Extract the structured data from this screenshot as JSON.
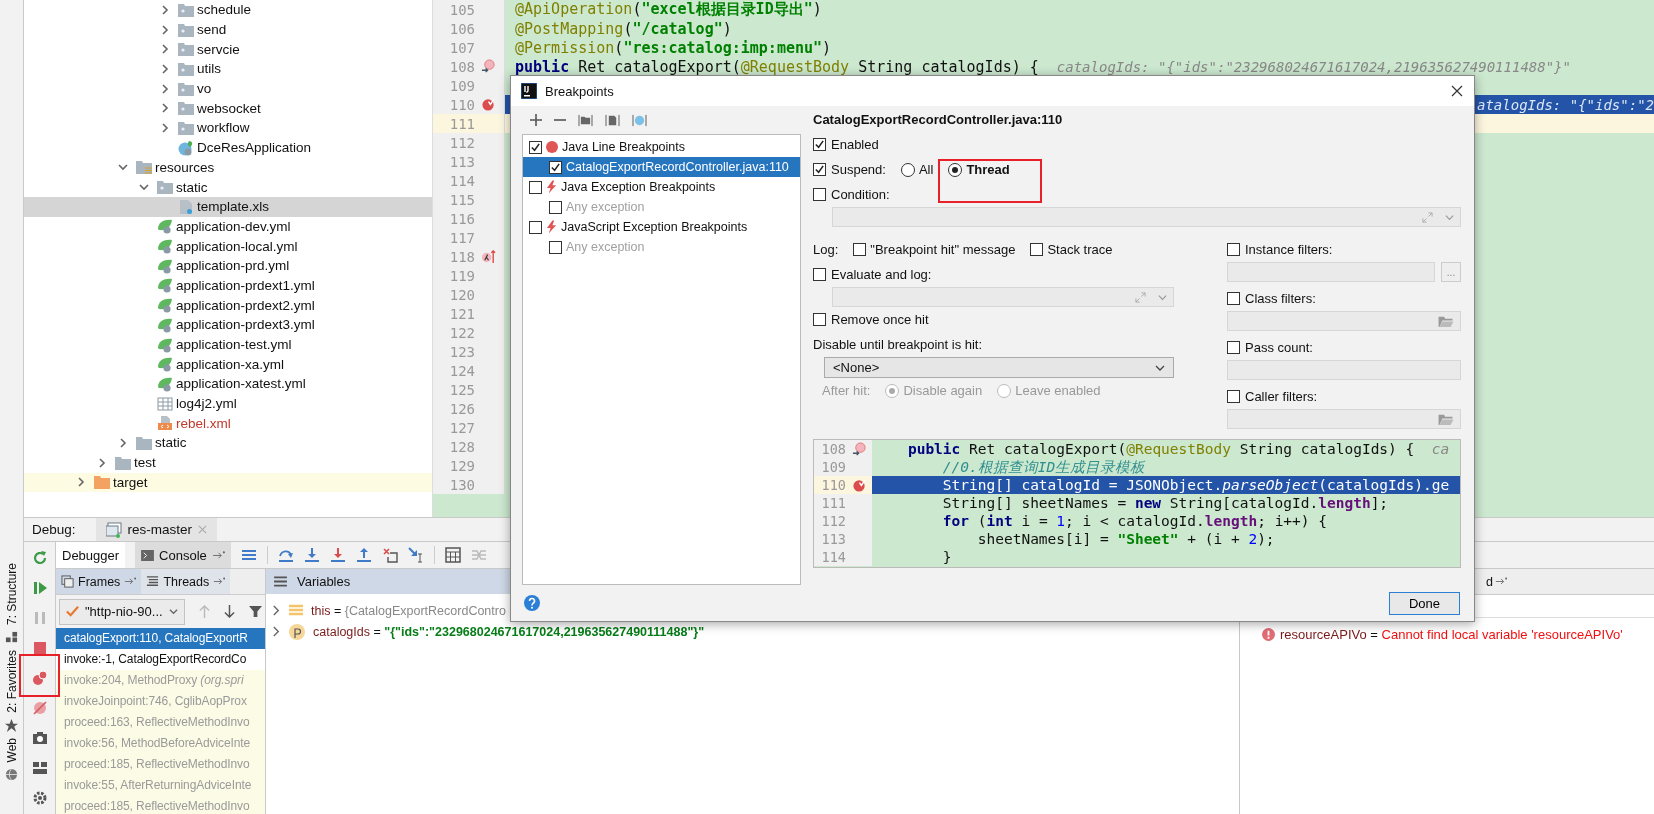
{
  "project_tree": [
    {
      "children": [
        {
          "children": [
            {
              "children": [
                {
                  "children": [
                    {
                      "label": "schedule",
                      "kind": "package",
                      "expanded": false,
                      "selected": false
                    },
                    {
                      "label": "send",
                      "kind": "package",
                      "expanded": false,
                      "selected": false
                    },
                    {
                      "label": "servcie",
                      "kind": "package",
                      "expanded": false,
                      "selected": false
                    },
                    {
                      "label": "utils",
                      "kind": "package",
                      "expanded": false,
                      "selected": false
                    },
                    {
                      "label": "vo",
                      "kind": "package",
                      "expanded": false,
                      "selected": false
                    },
                    {
                      "label": "websocket",
                      "kind": "package",
                      "expanded": false,
                      "selected": false
                    },
                    {
                      "label": "workflow",
                      "kind": "package",
                      "expanded": false,
                      "selected": false
                    },
                    {
                      "label": "DceResApplication",
                      "kind": "spring-class",
                      "selected": false
                    }
                  ]
                }
              ]
            },
            {
              "label": "resources",
              "kind": "resources",
              "expanded": true,
              "selected": false,
              "children": [
                {
                  "label": "static",
                  "kind": "package",
                  "expanded": true,
                  "selected": false,
                  "children": [
                    {
                      "label": "template.xls",
                      "kind": "unknown-file",
                      "selected": true
                    }
                  ]
                },
                {
                  "label": "application-dev.yml",
                  "kind": "spring-config",
                  "selected": false
                },
                {
                  "label": "application-local.yml",
                  "kind": "spring-config",
                  "selected": false
                },
                {
                  "label": "application-prd.yml",
                  "kind": "spring-config",
                  "selected": false
                },
                {
                  "label": "application-prdext1.yml",
                  "kind": "spring-config",
                  "selected": false
                },
                {
                  "label": "application-prdext2.yml",
                  "kind": "spring-config",
                  "selected": false
                },
                {
                  "label": "application-prdext3.yml",
                  "kind": "spring-config",
                  "selected": false
                },
                {
                  "label": "application-test.yml",
                  "kind": "spring-config",
                  "selected": false
                },
                {
                  "label": "application-xa.yml",
                  "kind": "spring-config",
                  "selected": false
                },
                {
                  "label": "application-xatest.yml",
                  "kind": "spring-config",
                  "selected": false
                },
                {
                  "label": "log4j2.yml",
                  "kind": "table-file",
                  "selected": false
                },
                {
                  "label": "rebel.xml",
                  "kind": "xml-file",
                  "selected": false
                }
              ]
            },
            {
              "label": "static",
              "kind": "plain-folder",
              "expanded": false,
              "selected": false
            }
          ]
        },
        {
          "label": "test",
          "kind": "plain-folder",
          "expanded": false,
          "selected": false
        }
      ]
    },
    {
      "label": "target",
      "kind": "excluded-folder",
      "expanded": false,
      "selected": false
    }
  ],
  "editor": {
    "lines": [
      {
        "number": "105",
        "highlighted": false,
        "caret": false,
        "code": [
          {
            "kind": "annotation",
            "text": "@ApiOperation"
          },
          {
            "kind": "plain",
            "text": "("
          },
          {
            "kind": "string",
            "text": "\"excel根据目录ID导出\""
          },
          {
            "kind": "plain",
            "text": ")"
          }
        ]
      },
      {
        "number": "106",
        "highlighted": false,
        "caret": false,
        "code": [
          {
            "kind": "annotation",
            "text": "@PostMapping"
          },
          {
            "kind": "plain",
            "text": "("
          },
          {
            "kind": "string",
            "text": "\"/catalog\""
          },
          {
            "kind": "plain",
            "text": ")"
          }
        ]
      },
      {
        "number": "107",
        "highlighted": false,
        "caret": false,
        "code": [
          {
            "kind": "annotation",
            "text": "@Permission"
          },
          {
            "kind": "plain",
            "text": "("
          },
          {
            "kind": "string",
            "text": "\"res:catalog:imp:menu\""
          },
          {
            "kind": "plain",
            "text": ")"
          }
        ]
      },
      {
        "number": "108",
        "kind": "override",
        "highlighted": false,
        "caret": false,
        "code": [
          {
            "kind": "keyword",
            "text": "public"
          },
          {
            "kind": "plain",
            "text": " Ret catalogExport("
          },
          {
            "kind": "annotation",
            "text": "@RequestBody"
          },
          {
            "kind": "plain",
            "text": " String catalogIds) {"
          }
        ],
        "hint": "catalogIds: \"{\"ids\":\"232968024671617024,219635627490111488\"}\""
      },
      {
        "number": "109",
        "highlighted": false,
        "caret": false
      },
      {
        "number": "110",
        "kind": "breakpoint",
        "highlighted": true,
        "caret": false,
        "hint": "atalogIds: \"{\"ids\":\"2"
      },
      {
        "number": "111",
        "highlighted": false,
        "caret": true
      },
      {
        "number": "112",
        "highlighted": false,
        "caret": false
      },
      {
        "number": "113",
        "highlighted": false,
        "caret": false
      },
      {
        "number": "114",
        "highlighted": false,
        "caret": false
      },
      {
        "number": "115",
        "highlighted": false,
        "caret": false
      },
      {
        "number": "116",
        "highlighted": false,
        "caret": false
      },
      {
        "number": "117",
        "highlighted": false,
        "caret": false
      },
      {
        "number": "118",
        "kind": "lambda",
        "highlighted": false,
        "caret": false
      },
      {
        "number": "119",
        "highlighted": false,
        "caret": false
      },
      {
        "number": "120",
        "highlighted": false,
        "caret": false
      },
      {
        "number": "121",
        "highlighted": false,
        "caret": false
      },
      {
        "number": "122",
        "highlighted": false,
        "caret": false
      },
      {
        "number": "123",
        "highlighted": false,
        "caret": false
      },
      {
        "number": "124",
        "highlighted": false,
        "caret": false
      },
      {
        "number": "125",
        "highlighted": false,
        "caret": false
      },
      {
        "number": "126",
        "highlighted": false,
        "caret": false
      },
      {
        "number": "127",
        "highlighted": false,
        "caret": false
      },
      {
        "number": "128",
        "highlighted": false,
        "caret": false
      },
      {
        "number": "129",
        "highlighted": false,
        "caret": false
      },
      {
        "number": "130",
        "highlighted": false,
        "caret": false
      }
    ]
  },
  "side_tabs": [
    "7: Structure",
    "2: Favorites",
    "Web"
  ],
  "debug": {
    "label": "Debug:",
    "session_tab": "res-master",
    "tabs": [
      {
        "label": "Debugger",
        "selected": true
      },
      {
        "label": "Console",
        "selected": false
      }
    ],
    "frame_tabs": [
      {
        "label": "Frames",
        "selected": true
      },
      {
        "label": "Threads",
        "selected": false
      }
    ],
    "thread": "\"http-nio-90...",
    "frames": [
      {
        "text": "catalogExport:110, CatalogExportR",
        "kind": "app",
        "selected": true
      },
      {
        "text": "invoke:-1, CatalogExportRecordCo",
        "kind": "app",
        "selected": false
      },
      {
        "text": "invoke:204, MethodProxy *(org.spri*",
        "kind": "library",
        "selected": false
      },
      {
        "text": "invokeJoinpoint:746, CglibAopProx",
        "kind": "library",
        "selected": false
      },
      {
        "text": "proceed:163, ReflectiveMethodInvo",
        "kind": "library",
        "selected": false
      },
      {
        "text": "invoke:56, MethodBeforeAdviceInte",
        "kind": "library",
        "selected": false
      },
      {
        "text": "proceed:185, ReflectiveMethodInvo",
        "kind": "library",
        "selected": false
      },
      {
        "text": "invoke:55, AfterReturningAdviceInte",
        "kind": "library",
        "selected": false
      },
      {
        "text": "proceed:185, ReflectiveMethodInvo",
        "kind": "library",
        "selected": false
      }
    ],
    "variables_title": "Variables",
    "variables": [
      {
        "name": "this",
        "sign": "=",
        "value": "{CatalogExportRecordContro",
        "kind": "object"
      },
      {
        "name": "catalogIds",
        "sign": "=",
        "value": "\"{\"ids\":\"232968024671617024,219635627490111488\"}\"",
        "kind": "param"
      }
    ],
    "watches": {
      "tab": "d",
      "items": [
        {
          "name": "resourceAPIVo",
          "sign": "=",
          "message": "Cannot find local variable 'resourceAPIVo'",
          "kind": "error"
        }
      ]
    }
  },
  "dialog": {
    "title": "Breakpoints",
    "groups": [
      {
        "label": "Java Line Breakpoints",
        "kind": "line",
        "checked": true,
        "selected": false,
        "children": [
          {
            "label": "CatalogExportRecordController.java:110",
            "checked": true,
            "selected": true,
            "disabled": false
          }
        ]
      },
      {
        "label": "Java Exception Breakpoints",
        "kind": "exception",
        "checked": false,
        "selected": false,
        "children": [
          {
            "label": "Any exception",
            "checked": false,
            "selected": false,
            "disabled": true
          }
        ]
      },
      {
        "label": "JavaScript Exception Breakpoints",
        "kind": "exception",
        "checked": false,
        "selected": false,
        "children": [
          {
            "label": "Any exception",
            "checked": false,
            "selected": false,
            "disabled": true
          }
        ]
      }
    ],
    "heading": "CatalogExportRecordController.java:110",
    "enabled": {
      "label": "Enabled",
      "checked": true
    },
    "suspend": {
      "label": "Suspend:",
      "checked": true,
      "options": [
        {
          "label": "All",
          "selected": false
        },
        {
          "label": "Thread",
          "selected": true
        }
      ]
    },
    "condition": {
      "label": "Condition:",
      "checked": false
    },
    "log_label": "Log:",
    "log_options": [
      {
        "label": "\"Breakpoint hit\" message",
        "checked": false
      },
      {
        "label": "Stack trace",
        "checked": false
      }
    ],
    "evaluate": {
      "label": "Evaluate and log:",
      "checked": false
    },
    "remove_once_hit": {
      "label": "Remove once hit",
      "checked": false
    },
    "disable_until": {
      "label": "Disable until breakpoint is hit:",
      "value": "<None>"
    },
    "after_hit": {
      "label": "After hit:",
      "disabled": true,
      "options": [
        {
          "label": "Disable again",
          "selected": true
        },
        {
          "label": "Leave enabled",
          "selected": false
        }
      ]
    },
    "filters": [
      {
        "label": "Instance filters:",
        "checked": false,
        "button_text": "..."
      },
      {
        "label": "Class filters:",
        "checked": false,
        "kind": "folder"
      },
      {
        "label": "Pass count:",
        "checked": false
      },
      {
        "label": "Caller filters:",
        "checked": false,
        "kind": "folder"
      }
    ],
    "preview": [
      {
        "number": "108",
        "kind": "override",
        "highlighted": false,
        "code": [
          {
            "kind": "keyword",
            "text": "    public"
          },
          {
            "kind": "plain",
            "text": " Ret catalogExport("
          },
          {
            "kind": "annotation",
            "text": "@RequestBody"
          },
          {
            "kind": "plain",
            "text": " String catalogIds) {  "
          },
          {
            "kind": "hint",
            "text": "ca"
          }
        ]
      },
      {
        "number": "109",
        "highlighted": false,
        "code": [
          {
            "kind": "comment",
            "text": "        //0.根据查询ID生成目录模板"
          }
        ]
      },
      {
        "number": "110",
        "kind": "breakpoint",
        "highlighted": true,
        "code": [
          {
            "kind": "plain",
            "text": "        String[] catalogId = JSONObject."
          },
          {
            "kind": "italic",
            "text": "parseObject"
          },
          {
            "kind": "plain",
            "text": "(catalogIds).ge"
          }
        ]
      },
      {
        "number": "111",
        "highlighted": false,
        "code": [
          {
            "kind": "plain",
            "text": "        String[] sheetNames = "
          },
          {
            "kind": "keyword",
            "text": "new"
          },
          {
            "kind": "plain",
            "text": " String[catalogId."
          },
          {
            "kind": "field",
            "text": "length"
          },
          {
            "kind": "plain",
            "text": "];"
          }
        ]
      },
      {
        "number": "112",
        "highlighted": false,
        "code": [
          {
            "kind": "keyword",
            "text": "        for"
          },
          {
            "kind": "plain",
            "text": " ("
          },
          {
            "kind": "keyword",
            "text": "int"
          },
          {
            "kind": "plain",
            "text": " i = "
          },
          {
            "kind": "number",
            "text": "1"
          },
          {
            "kind": "plain",
            "text": "; i < catalogId."
          },
          {
            "kind": "field",
            "text": "length"
          },
          {
            "kind": "plain",
            "text": "; i++) {"
          }
        ]
      },
      {
        "number": "113",
        "highlighted": false,
        "code": [
          {
            "kind": "plain",
            "text": "            sheetNames[i] = "
          },
          {
            "kind": "string",
            "text": "\"Sheet\""
          },
          {
            "kind": "plain",
            "text": " + (i + "
          },
          {
            "kind": "number",
            "text": "2"
          },
          {
            "kind": "plain",
            "text": ");"
          }
        ]
      },
      {
        "number": "114",
        "highlighted": false,
        "code": [
          {
            "kind": "plain",
            "text": "        }"
          }
        ]
      }
    ],
    "done": "Done"
  }
}
